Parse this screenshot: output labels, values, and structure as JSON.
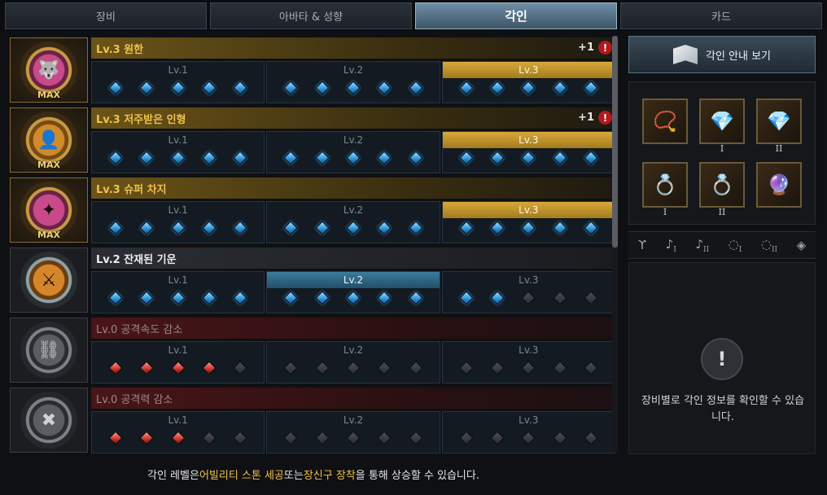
{
  "tabs": [
    {
      "label": "장비",
      "active": false
    },
    {
      "label": "아바타 & 성향",
      "active": false
    },
    {
      "label": "각인",
      "active": true
    },
    {
      "label": "카드",
      "active": false
    }
  ],
  "engravings": [
    {
      "title": "Lv.3 원한",
      "style": "gold",
      "max_label": "MAX",
      "icon": "wolf-portrait-icon",
      "bonus": "+1",
      "alert": "!",
      "levels": [
        {
          "label": "Lv.1",
          "state": "normal",
          "gems": [
            "blue",
            "blue",
            "blue",
            "blue",
            "blue"
          ]
        },
        {
          "label": "Lv.2",
          "state": "normal",
          "gems": [
            "blue",
            "blue",
            "blue",
            "blue",
            "blue"
          ]
        },
        {
          "label": "Lv.3",
          "state": "gold",
          "gems": [
            "blue",
            "blue",
            "blue",
            "blue",
            "blue"
          ]
        }
      ]
    },
    {
      "title": "Lv.3 저주받은 인형",
      "style": "gold",
      "max_label": "MAX",
      "icon": "cursed-doll-icon",
      "bonus": "+1",
      "alert": "!",
      "levels": [
        {
          "label": "Lv.1",
          "state": "normal",
          "gems": [
            "blue",
            "blue",
            "blue",
            "blue",
            "blue"
          ]
        },
        {
          "label": "Lv.2",
          "state": "normal",
          "gems": [
            "blue",
            "blue",
            "blue",
            "blue",
            "blue"
          ]
        },
        {
          "label": "Lv.3",
          "state": "gold",
          "gems": [
            "blue",
            "blue",
            "blue",
            "blue",
            "blue"
          ]
        }
      ]
    },
    {
      "title": "Lv.3 슈퍼 차지",
      "style": "gold",
      "max_label": "MAX",
      "icon": "super-charge-icon",
      "bonus": "",
      "alert": "",
      "levels": [
        {
          "label": "Lv.1",
          "state": "normal",
          "gems": [
            "blue",
            "blue",
            "blue",
            "blue",
            "blue"
          ]
        },
        {
          "label": "Lv.2",
          "state": "normal",
          "gems": [
            "blue",
            "blue",
            "blue",
            "blue",
            "blue"
          ]
        },
        {
          "label": "Lv.3",
          "state": "gold",
          "gems": [
            "blue",
            "blue",
            "blue",
            "blue",
            "blue"
          ]
        }
      ]
    },
    {
      "title": "Lv.2 잔재된 기운",
      "style": "normal",
      "max_label": "",
      "icon": "remnant-energy-icon",
      "bonus": "",
      "alert": "",
      "levels": [
        {
          "label": "Lv.1",
          "state": "normal",
          "gems": [
            "blue",
            "blue",
            "blue",
            "blue",
            "blue"
          ]
        },
        {
          "label": "Lv.2",
          "state": "blue",
          "gems": [
            "blue",
            "blue",
            "blue",
            "blue",
            "blue"
          ]
        },
        {
          "label": "Lv.3",
          "state": "normal",
          "gems": [
            "blue",
            "blue",
            "empty",
            "empty",
            "empty"
          ]
        }
      ]
    },
    {
      "title": "Lv.0 공격속도 감소",
      "style": "red",
      "max_label": "",
      "icon": "attack-speed-down-icon",
      "bonus": "",
      "alert": "",
      "levels": [
        {
          "label": "Lv.1",
          "state": "normal",
          "gems": [
            "red",
            "red",
            "red",
            "red",
            "empty"
          ]
        },
        {
          "label": "Lv.2",
          "state": "normal",
          "gems": [
            "empty",
            "empty",
            "empty",
            "empty",
            "empty"
          ]
        },
        {
          "label": "Lv.3",
          "state": "normal",
          "gems": [
            "empty",
            "empty",
            "empty",
            "empty",
            "empty"
          ]
        }
      ]
    },
    {
      "title": "Lv.0 공격력 감소",
      "style": "red",
      "max_label": "",
      "icon": "attack-power-down-icon",
      "bonus": "",
      "alert": "",
      "levels": [
        {
          "label": "Lv.1",
          "state": "normal",
          "gems": [
            "red",
            "red",
            "red",
            "empty",
            "empty"
          ]
        },
        {
          "label": "Lv.2",
          "state": "normal",
          "gems": [
            "empty",
            "empty",
            "empty",
            "empty",
            "empty"
          ]
        },
        {
          "label": "Lv.3",
          "state": "normal",
          "gems": [
            "empty",
            "empty",
            "empty",
            "empty",
            "empty"
          ]
        }
      ]
    }
  ],
  "footer": {
    "prefix": "각인 레벨은 ",
    "highlight1": "어빌리티 스톤 세공",
    "middle": " 또는 ",
    "highlight2": "장신구 장착",
    "suffix": "을 통해 상승할 수 있습니다."
  },
  "right_panel": {
    "guide_button": "각인 안내 보기",
    "slots": [
      {
        "icon": "necklace-icon",
        "glyph": "📿",
        "num": ""
      },
      {
        "icon": "earring-icon",
        "glyph": "💎",
        "num": "I"
      },
      {
        "icon": "earring-icon",
        "glyph": "💎",
        "num": "II"
      },
      {
        "icon": "ring-icon",
        "glyph": "💍",
        "num": "I"
      },
      {
        "icon": "ring-icon",
        "glyph": "💍",
        "num": "II"
      },
      {
        "icon": "ability-stone-icon",
        "glyph": "🔮",
        "num": ""
      }
    ],
    "filters": [
      {
        "icon": "necklace-filter-icon",
        "glyph": "ϒ",
        "num": ""
      },
      {
        "icon": "earring-filter-icon",
        "glyph": "♪",
        "num": "I"
      },
      {
        "icon": "earring-filter-icon",
        "glyph": "♪",
        "num": "II"
      },
      {
        "icon": "ring-filter-icon",
        "glyph": "◌",
        "num": "I"
      },
      {
        "icon": "ring-filter-icon",
        "glyph": "◌",
        "num": "II"
      },
      {
        "icon": "stone-filter-icon",
        "glyph": "◈",
        "num": ""
      }
    ],
    "info_mark": "!",
    "info_text": "장비별로 각인 정보를 확인할 수 있습니다."
  }
}
